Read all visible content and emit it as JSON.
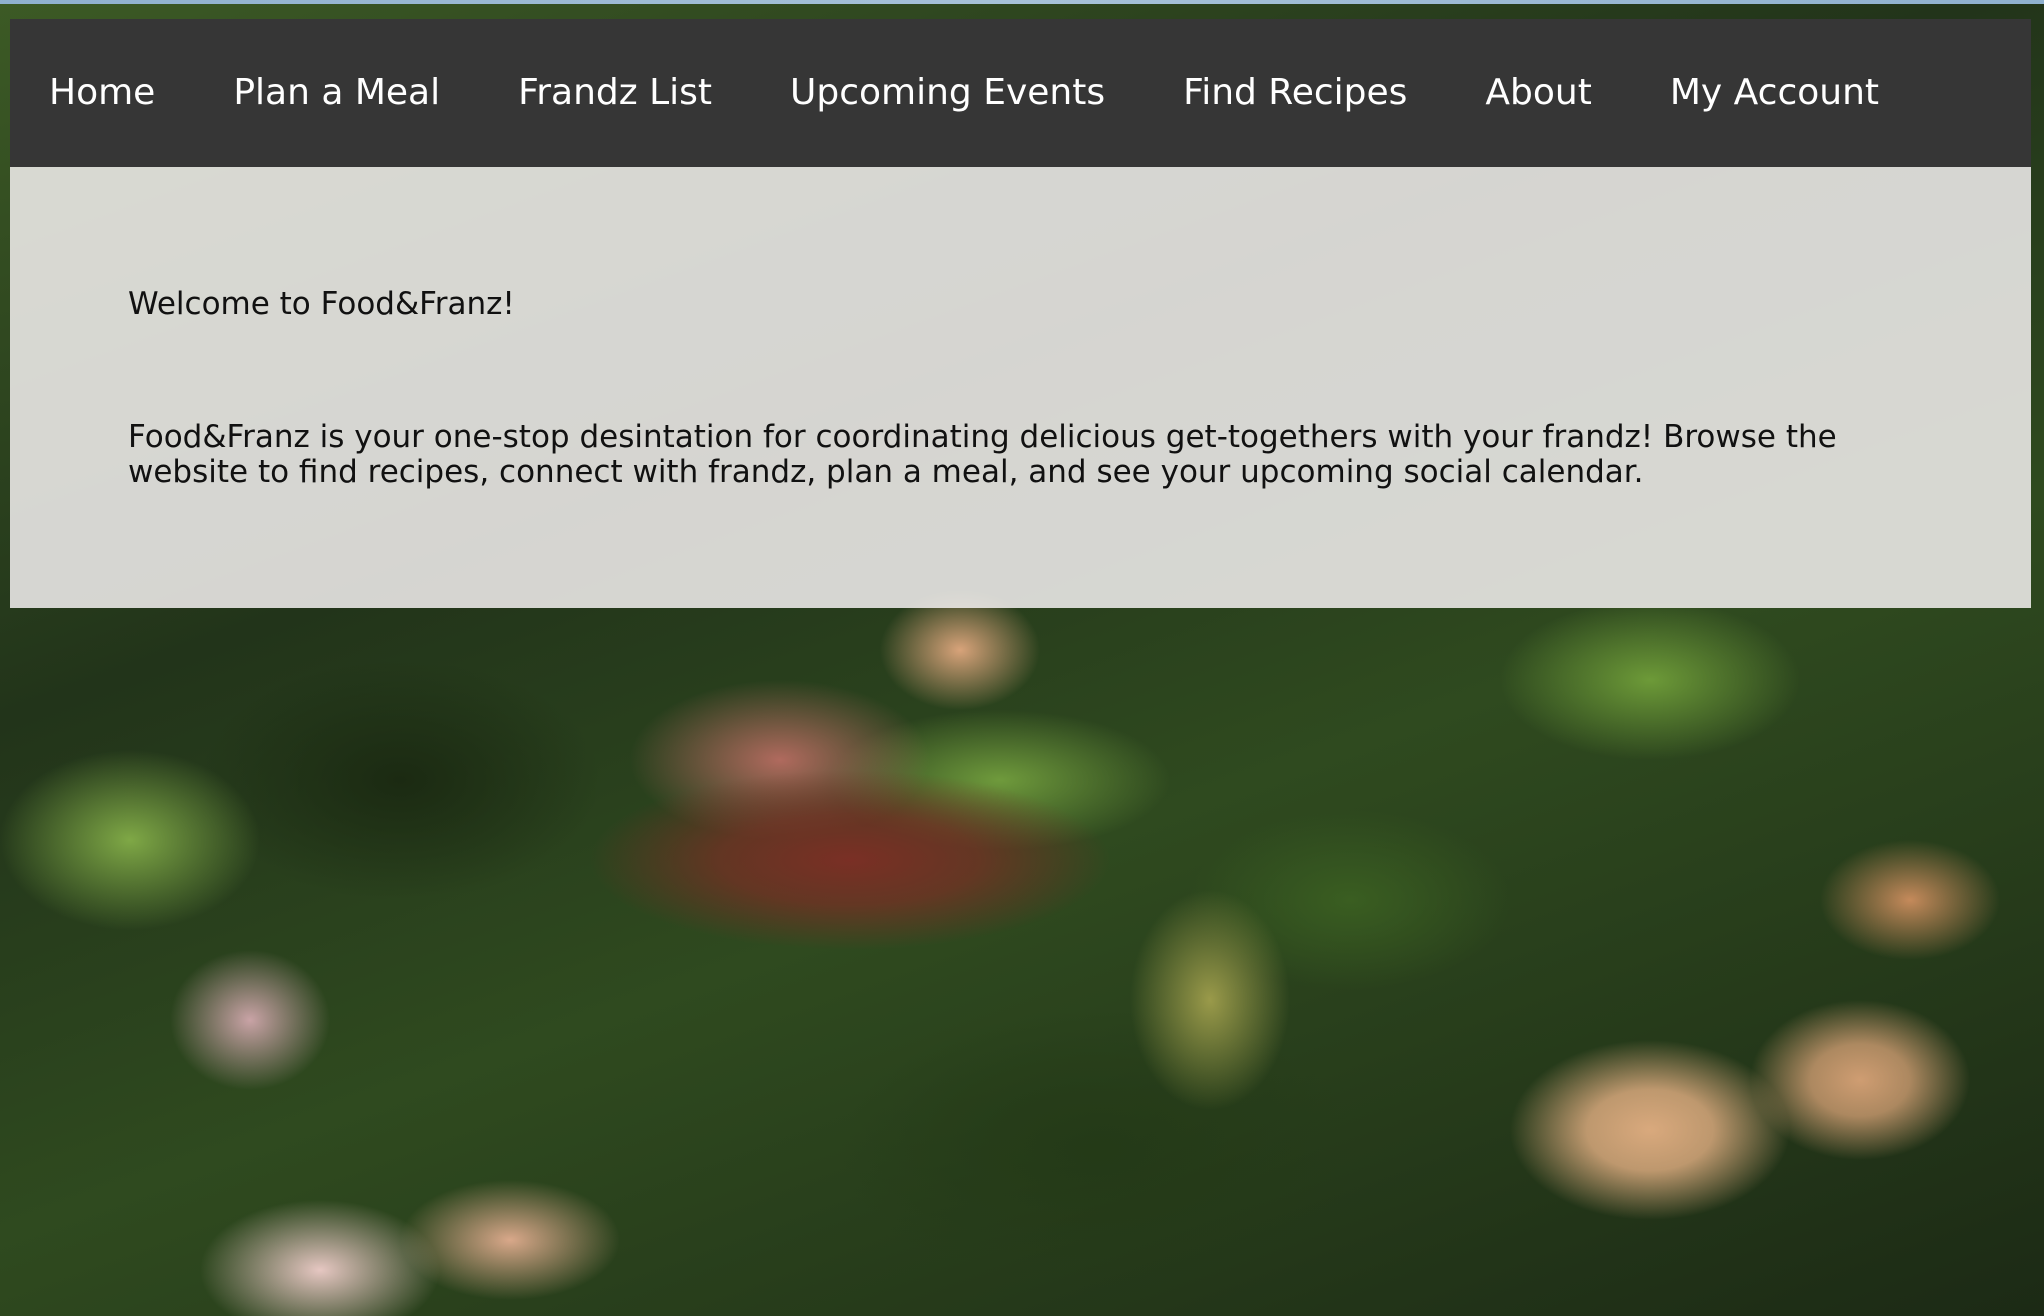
{
  "nav": {
    "items": [
      {
        "label": "Home"
      },
      {
        "label": "Plan a Meal"
      },
      {
        "label": "Frandz List"
      },
      {
        "label": "Upcoming Events"
      },
      {
        "label": "Find Recipes"
      },
      {
        "label": "About"
      },
      {
        "label": "My Account"
      }
    ]
  },
  "main": {
    "welcome": "Welcome to Food&Franz!",
    "description": "Food&Franz is your one-stop desintation for coordinating delicious get-togethers with your frandz! Browse the website to find recipes, connect with frandz, plan a meal, and see your upcoming social calendar."
  },
  "colors": {
    "nav_background": "#363636",
    "nav_text": "#ffffff",
    "panel_background": "#f3f0f0"
  },
  "background_image": "salad-photo"
}
